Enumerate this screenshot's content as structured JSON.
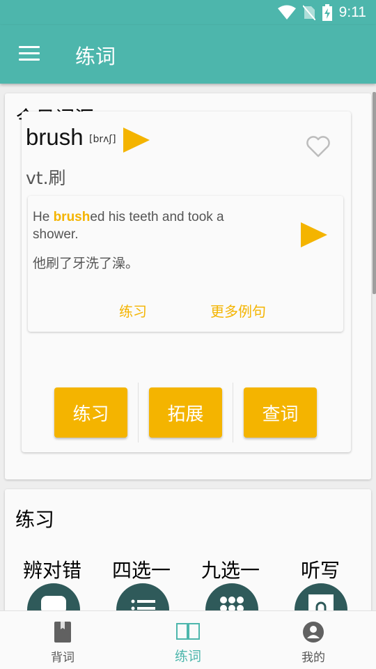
{
  "status_bar": {
    "time": "9:11"
  },
  "app_bar": {
    "title": "练词"
  },
  "today_card": {
    "title": "今日词汇"
  },
  "word_card": {
    "word": "brush",
    "phonetic": "[brʌʃ]",
    "meaning": "vt.刷",
    "example": {
      "en_before": "He ",
      "en_highlight": "brush",
      "en_after": "ed his teeth and took a shower.",
      "cn": "他刷了牙洗了澡。",
      "practice_link": "练习",
      "more_link": "更多例句"
    },
    "buttons": {
      "practice": "练习",
      "expand": "拓展",
      "lookup": "查词"
    }
  },
  "practice_card": {
    "title": "练习",
    "modes": [
      {
        "label": "辨对错",
        "icon": "speech-bubble-icon"
      },
      {
        "label": "四选一",
        "icon": "list-icon"
      },
      {
        "label": "九选一",
        "icon": "grid-icon"
      },
      {
        "label": "听写",
        "icon": "listen-icon"
      }
    ]
  },
  "bottom_nav": {
    "items": [
      {
        "label": "背词",
        "icon": "book-icon",
        "active": false
      },
      {
        "label": "练词",
        "icon": "open-book-icon",
        "active": true
      },
      {
        "label": "我的",
        "icon": "account-icon",
        "active": false
      }
    ]
  },
  "colors": {
    "primary": "#4db6ac",
    "accent": "#f4b400",
    "circle": "#2f5a5a"
  }
}
